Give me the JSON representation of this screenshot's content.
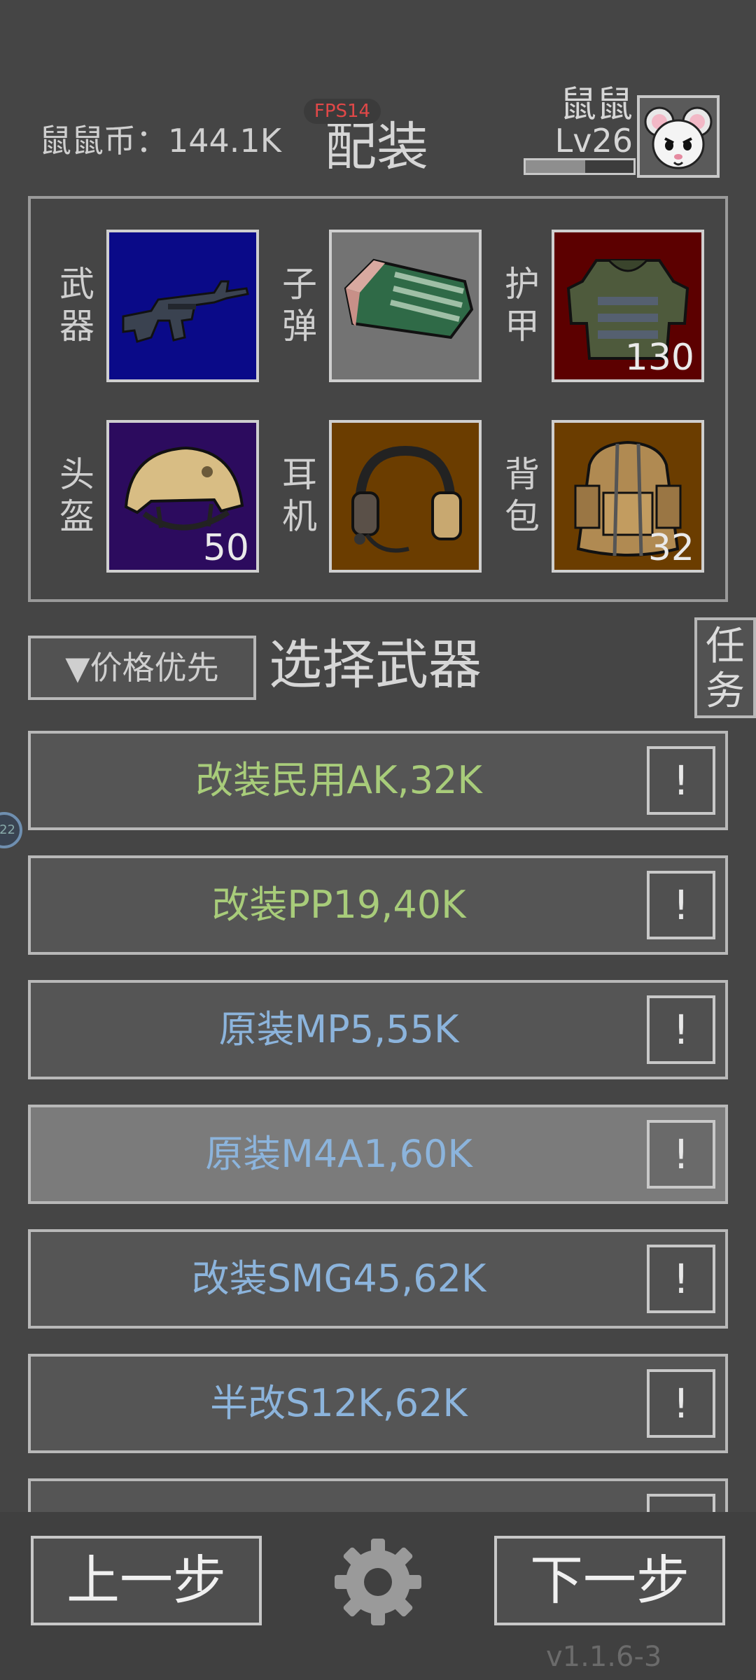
{
  "header": {
    "coins": "鼠鼠币：144.1K",
    "fps": "FPS14",
    "title": "配装",
    "username": "鼠鼠",
    "level": "Lv26",
    "xp_progress": 0.55
  },
  "slots": [
    {
      "label": "武器",
      "count": "",
      "bg": "#0a0a88",
      "icon": "rifle-icon"
    },
    {
      "label": "子弹",
      "count": "",
      "bg": "#737373",
      "icon": "ammo-box-icon"
    },
    {
      "label": "护甲",
      "count": "130",
      "bg": "#5c0000",
      "icon": "body-armor-icon"
    },
    {
      "label": "头盔",
      "count": "50",
      "bg": "#2c0b5e",
      "icon": "helmet-icon"
    },
    {
      "label": "耳机",
      "count": "",
      "bg": "#6b3d00",
      "icon": "headset-icon"
    },
    {
      "label": "背包",
      "count": "32",
      "bg": "#6b3d00",
      "icon": "backpack-icon"
    }
  ],
  "sort": {
    "label": "▼价格优先"
  },
  "section_title": "选择武器",
  "task_button": {
    "label": "任务"
  },
  "weapons": [
    {
      "label": "改装民用AK,32K",
      "color": "#a8cc7a",
      "selected": false
    },
    {
      "label": "改装PP19,40K",
      "color": "#a8cc7a",
      "selected": false
    },
    {
      "label": "原装MP5,55K",
      "color": "#8cb4dc",
      "selected": false
    },
    {
      "label": "原装M4A1,60K",
      "color": "#8cb4dc",
      "selected": true
    },
    {
      "label": "改装SMG45,62K",
      "color": "#8cb4dc",
      "selected": false
    },
    {
      "label": "半改S12K,62K",
      "color": "#8cb4dc",
      "selected": false
    },
    {
      "label": "",
      "color": "#8cb4dc",
      "selected": false
    }
  ],
  "info_label": "!",
  "side_badge": "22",
  "footer": {
    "prev": "上一步",
    "next": "下一步",
    "version": "v1.1.6-3"
  }
}
